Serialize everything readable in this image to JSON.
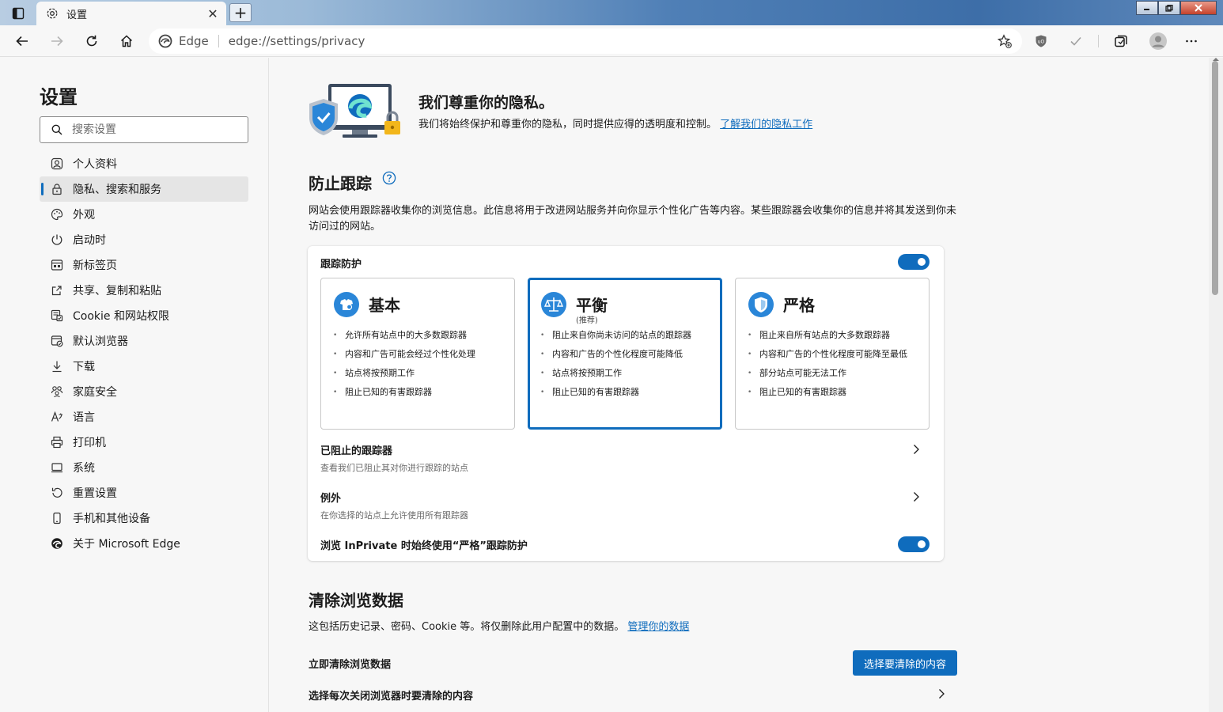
{
  "browser": {
    "tab_title": "设置",
    "tab_close_glyph": "✕",
    "new_tab_glyph": "+",
    "site_label": "Edge",
    "url": "edge://settings/privacy"
  },
  "sidebar": {
    "title": "设置",
    "search_placeholder": "搜索设置",
    "items": [
      {
        "label": "个人资料",
        "icon": "profile-icon"
      },
      {
        "label": "隐私、搜索和服务",
        "icon": "lock-icon",
        "active": true
      },
      {
        "label": "外观",
        "icon": "appearance-icon"
      },
      {
        "label": "启动时",
        "icon": "power-icon"
      },
      {
        "label": "新标签页",
        "icon": "new-tab-icon"
      },
      {
        "label": "共享、复制和粘贴",
        "icon": "share-icon"
      },
      {
        "label": "Cookie 和网站权限",
        "icon": "site-permissions-icon"
      },
      {
        "label": "默认浏览器",
        "icon": "default-browser-icon"
      },
      {
        "label": "下载",
        "icon": "download-icon"
      },
      {
        "label": "家庭安全",
        "icon": "family-icon"
      },
      {
        "label": "语言",
        "icon": "language-icon"
      },
      {
        "label": "打印机",
        "icon": "printer-icon"
      },
      {
        "label": "系统",
        "icon": "system-icon"
      },
      {
        "label": "重置设置",
        "icon": "reset-icon"
      },
      {
        "label": "手机和其他设备",
        "icon": "phone-icon"
      },
      {
        "label": "关于 Microsoft Edge",
        "icon": "edge-logo-icon"
      }
    ]
  },
  "hero": {
    "title": "我们尊重你的隐私。",
    "desc": "我们将始终保护和尊重你的隐私，同时提供应得的透明度和控制。",
    "link": "了解我们的隐私工作"
  },
  "tracking": {
    "title": "防止跟踪",
    "desc": "网站会使用跟踪器收集你的浏览信息。此信息将用于改进网站服务并向你显示个性化广告等内容。某些跟踪器会收集你的信息并将其发送到你未访问过的网站。",
    "protection_label": "跟踪防护",
    "protection_on": true,
    "modes": [
      {
        "name": "基本",
        "tag": "",
        "icon": "basic-mode-icon",
        "points": [
          "允许所有站点中的大多数跟踪器",
          "内容和广告可能会经过个性化处理",
          "站点将按预期工作",
          "阻止已知的有害跟踪器"
        ]
      },
      {
        "name": "平衡",
        "tag": "(推荐)",
        "icon": "balanced-mode-icon",
        "selected": true,
        "points": [
          "阻止来自你尚未访问的站点的跟踪器",
          "内容和广告的个性化程度可能降低",
          "站点将按预期工作",
          "阻止已知的有害跟踪器"
        ]
      },
      {
        "name": "严格",
        "tag": "",
        "icon": "strict-mode-icon",
        "points": [
          "阻止来自所有站点的大多数跟踪器",
          "内容和广告的个性化程度可能降至最低",
          "部分站点可能无法工作",
          "阻止已知的有害跟踪器"
        ]
      }
    ],
    "blocked_label": "已阻止的跟踪器",
    "blocked_sub": "查看我们已阻止其对你进行跟踪的站点",
    "exceptions_label": "例外",
    "exceptions_sub": "在你选择的站点上允许使用所有跟踪器",
    "inprivate_label": "浏览 InPrivate 时始终使用“严格”跟踪防护",
    "inprivate_on": true
  },
  "clear": {
    "title": "清除浏览数据",
    "desc": "这包括历史记录、密码、Cookie 等。将仅删除此用户配置中的数据。",
    "link": "管理你的数据",
    "now_label": "立即清除浏览数据",
    "button": "选择要清除的内容",
    "on_close_label": "选择每次关闭浏览器时要清除的内容"
  },
  "colors": {
    "accent": "#0f6cbd"
  }
}
